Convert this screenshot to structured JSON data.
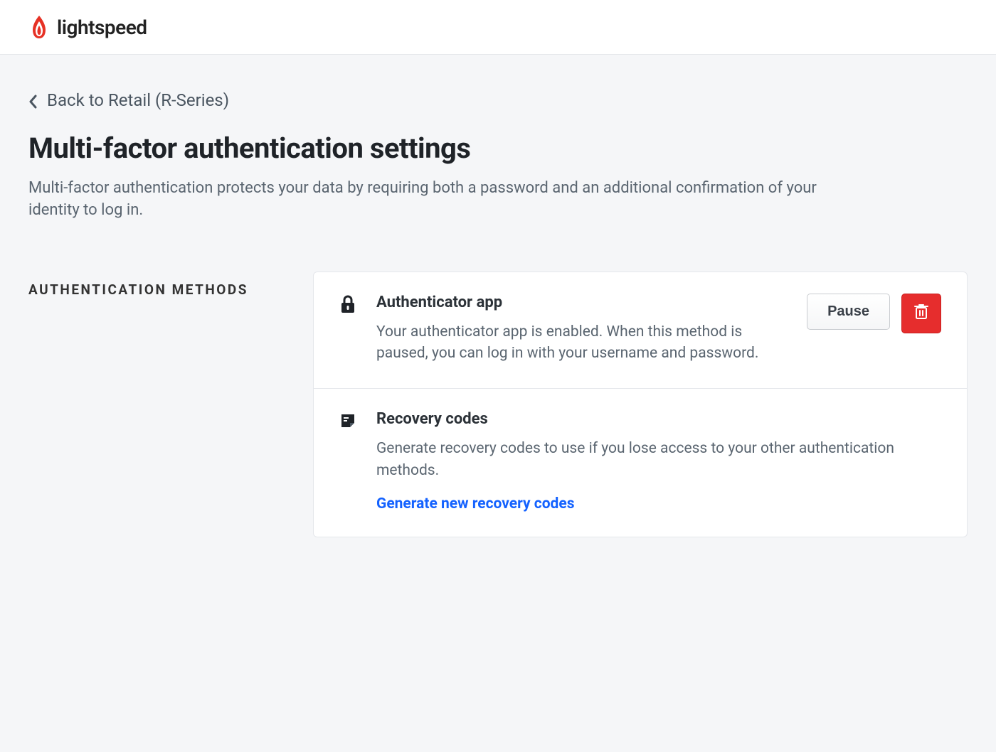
{
  "brand": {
    "name": "lightspeed"
  },
  "nav": {
    "back_label": "Back to Retail (R-Series)"
  },
  "page": {
    "title": "Multi-factor authentication settings",
    "description": "Multi-factor authentication protects your data by requiring both a password and an additional confirmation of your identity to log in."
  },
  "section": {
    "heading": "Authentication methods"
  },
  "methods": {
    "authenticator": {
      "title": "Authenticator app",
      "description": "Your authenticator app is enabled. When this method is paused, you can log in with your username and password.",
      "pause_label": "Pause"
    },
    "recovery": {
      "title": "Recovery codes",
      "description": "Generate recovery codes to use if you lose access to your other authentication methods.",
      "generate_label": "Generate new recovery codes"
    }
  }
}
